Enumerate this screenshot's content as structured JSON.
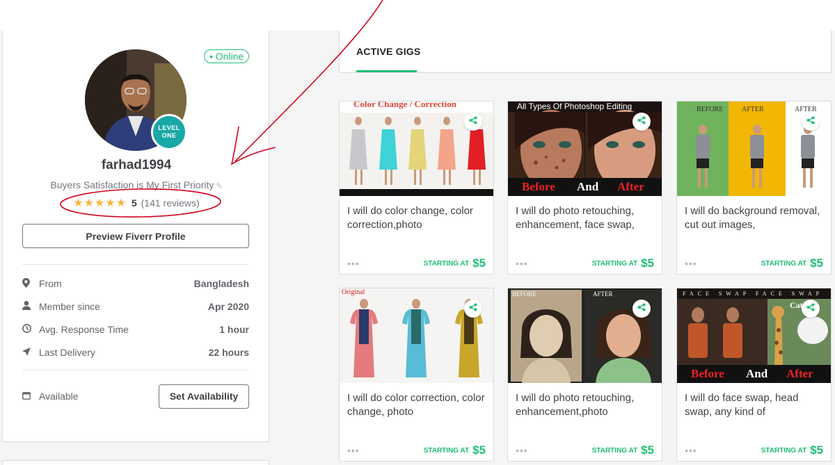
{
  "profile": {
    "status": "• Online",
    "level_line1": "LEVEL",
    "level_line2": "ONE",
    "username": "farhad1994",
    "tagline": "Buyers Satisfaction is My First Priority",
    "stars": "★★★★★",
    "rating": "5",
    "review_count": "(141 reviews)",
    "preview_button": "Preview Fiverr Profile",
    "stats": [
      {
        "icon": "location-icon",
        "label": "From",
        "value": "Bangladesh"
      },
      {
        "icon": "user-icon",
        "label": "Member since",
        "value": "Apr 2020"
      },
      {
        "icon": "clock-icon",
        "label": "Avg. Response Time",
        "value": "1 hour"
      },
      {
        "icon": "send-icon",
        "label": "Last Delivery",
        "value": "22 hours"
      }
    ],
    "availability_label": "Available",
    "availability_button": "Set Availability"
  },
  "tabs": {
    "active": "ACTIVE GIGS"
  },
  "gig_common": {
    "dots": "•••",
    "starting_at": "STARTING AT"
  },
  "gigs": [
    {
      "title": "I will do color change, color correction,photo",
      "price": "$5",
      "banner": "Color Change / Correction"
    },
    {
      "title": "I will do photo retouching, enhancement, face swap,",
      "price": "$5",
      "banner": "All Types Of Photoshop Editing",
      "before": "Before",
      "and": "And",
      "after": "After"
    },
    {
      "title": "I will do background removal, cut out images,",
      "price": "$5",
      "label_before": "BEFORE",
      "label_after": "AFTER",
      "label_after2": "AFTER"
    },
    {
      "title": "I will do color correction, color change, photo",
      "price": "$5",
      "label_original": "Original"
    },
    {
      "title": "I will do photo retouching, enhancement,photo",
      "price": "$5",
      "label_before": "BEFORE",
      "label_after": "AFTER"
    },
    {
      "title": "I will do face swap, head swap, any kind of",
      "price": "$5",
      "banner": "FACE SWAP FACE SWAP",
      "cat": "Cat F",
      "before": "Before",
      "and": "And",
      "after": "After"
    }
  ],
  "colors": {
    "accent": "#1dbf73",
    "level_badge": "#1aa7a7",
    "star": "#ffb33e",
    "annotation": "#d0021b"
  }
}
